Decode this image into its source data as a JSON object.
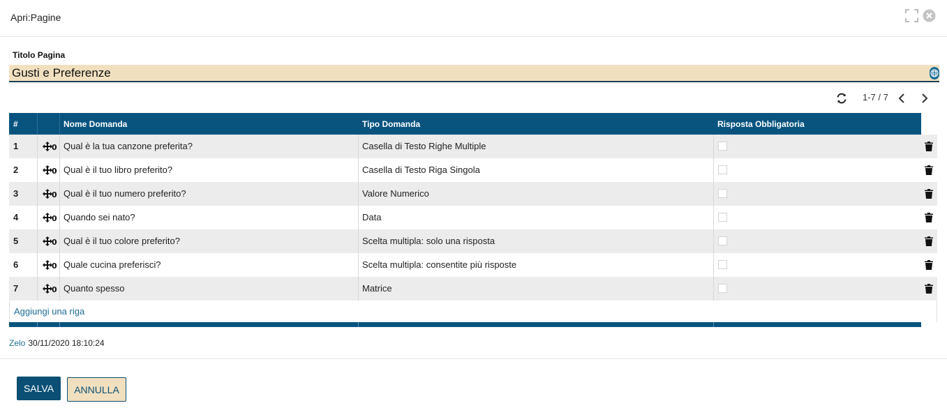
{
  "window": {
    "title": "Apri:Pagine"
  },
  "form": {
    "title_label": "Titolo Pagina",
    "title_value": "Gusti e Preferenze"
  },
  "pager": {
    "range": "1-7 / 7"
  },
  "grid": {
    "columns": [
      "#",
      "Nome Domanda",
      "Tipo Domanda",
      "Risposta Obbligatoria"
    ],
    "rows": [
      {
        "num": "1",
        "name": "Qual è la tua canzone preferita?",
        "type": "Casella di Testo Righe Multiple",
        "required": false
      },
      {
        "num": "2",
        "name": "Qual è il tuo libro preferito?",
        "type": "Casella di Testo Riga Singola",
        "required": false
      },
      {
        "num": "3",
        "name": "Qual è il tuo numero preferito?",
        "type": "Valore Numerico",
        "required": false
      },
      {
        "num": "4",
        "name": "Quando sei nato?",
        "type": "Data",
        "required": false
      },
      {
        "num": "5",
        "name": "Qual è il tuo colore preferito?",
        "type": "Scelta multipla: solo una risposta",
        "required": false
      },
      {
        "num": "6",
        "name": "Quale cucina preferisci?",
        "type": "Scelta multipla: consentite più risposte",
        "required": false
      },
      {
        "num": "7",
        "name": "Quanto spesso",
        "type": "Matrice",
        "required": false
      }
    ],
    "add_row_label": "Aggiungi una riga"
  },
  "meta": {
    "user": "Zelo",
    "timestamp": "30/11/2020 18:10:24"
  },
  "buttons": {
    "save": "SALVA",
    "cancel": "ANNULLA"
  },
  "icons": {
    "expand": "expand-icon",
    "close": "close-icon",
    "language": "globe-icon",
    "refresh": "refresh-icon",
    "prev": "chevron-left-icon",
    "next": "chevron-right-icon",
    "drag": "move-handle-icon",
    "delete": "trash-icon"
  },
  "colors": {
    "header": "#08547f",
    "input_bg": "#f1e0bf",
    "link": "#1e6e96"
  }
}
